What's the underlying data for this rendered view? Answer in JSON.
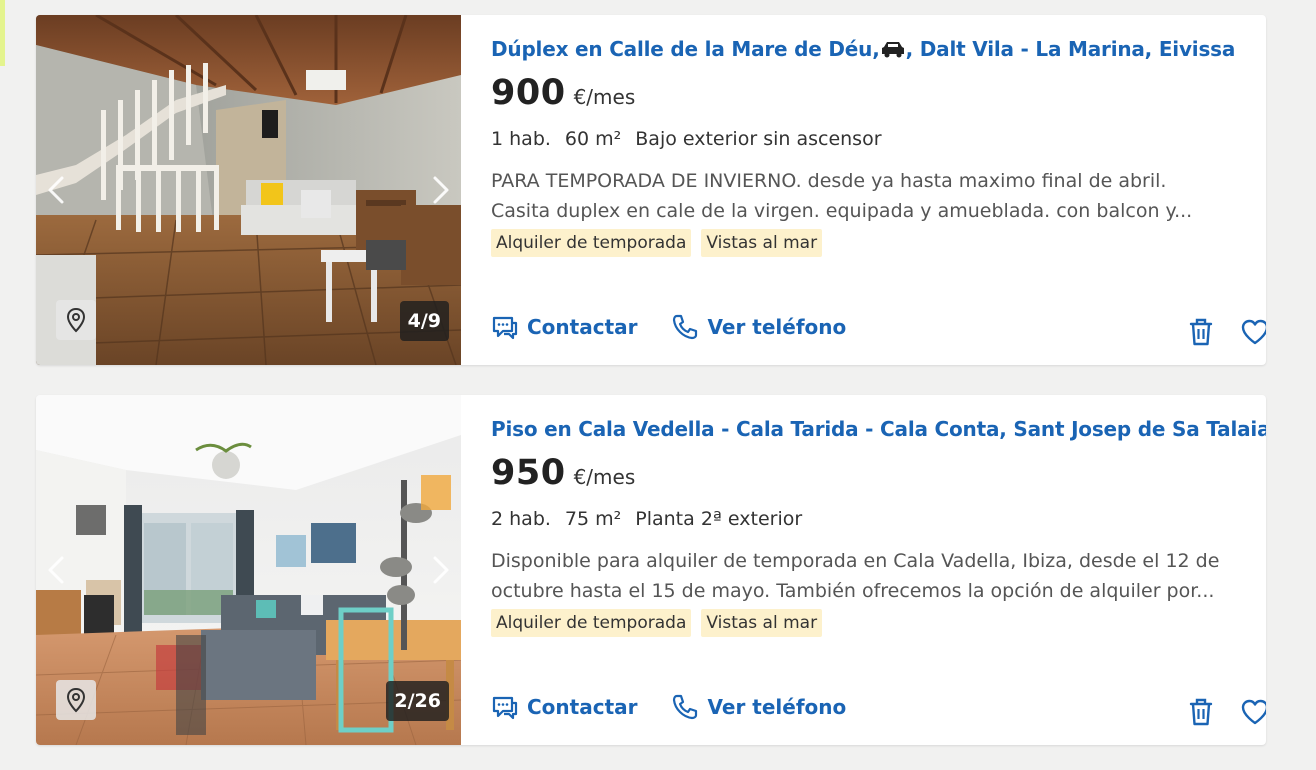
{
  "colors": {
    "link": "#1a64b4",
    "tag_bg": "#fdf1cc",
    "page_bg": "#f1f1f0"
  },
  "listings": [
    {
      "title_part1": "Dúplex en Calle de la Mare de Déu,",
      "title_part2": ", Dalt Vila - La Marina, Eivissa",
      "price": "900",
      "price_unit": "€/mes",
      "rooms": "1 hab.",
      "area": "60 m²",
      "floor": "Bajo exterior sin ascensor",
      "description_line1": "PARA TEMPORADA DE INVIERNO. desde ya hasta maximo final de abril.",
      "description_line2": "Casita duplex en cale de la virgen. equipada y amueblada. con balcon y...",
      "tags": [
        "Alquiler de temporada",
        "Vistas al mar"
      ],
      "photo_counter": "4/9",
      "contact_label": "Contactar",
      "phone_label": "Ver teléfono"
    },
    {
      "title_part1": "Piso en Cala Vedella - Cala Tarida - Cala Conta, Sant Josep de Sa Talaia",
      "title_part2": "",
      "price": "950",
      "price_unit": "€/mes",
      "rooms": "2 hab.",
      "area": "75 m²",
      "floor": "Planta 2ª exterior",
      "description_line1": "Disponible para alquiler de temporada en Cala Vadella, Ibiza, desde el 12 de",
      "description_line2": "octubre hasta el 15 de mayo. También ofrecemos la opción de alquiler por...",
      "tags": [
        "Alquiler de temporada",
        "Vistas al mar"
      ],
      "photo_counter": "2/26",
      "contact_label": "Contactar",
      "phone_label": "Ver teléfono"
    }
  ],
  "icons": {
    "prev": "chevron-left-icon",
    "next": "chevron-right-icon",
    "map": "map-pin-icon",
    "contact": "chat-icon",
    "phone": "phone-icon",
    "trash": "trash-icon",
    "favorite": "heart-icon"
  }
}
